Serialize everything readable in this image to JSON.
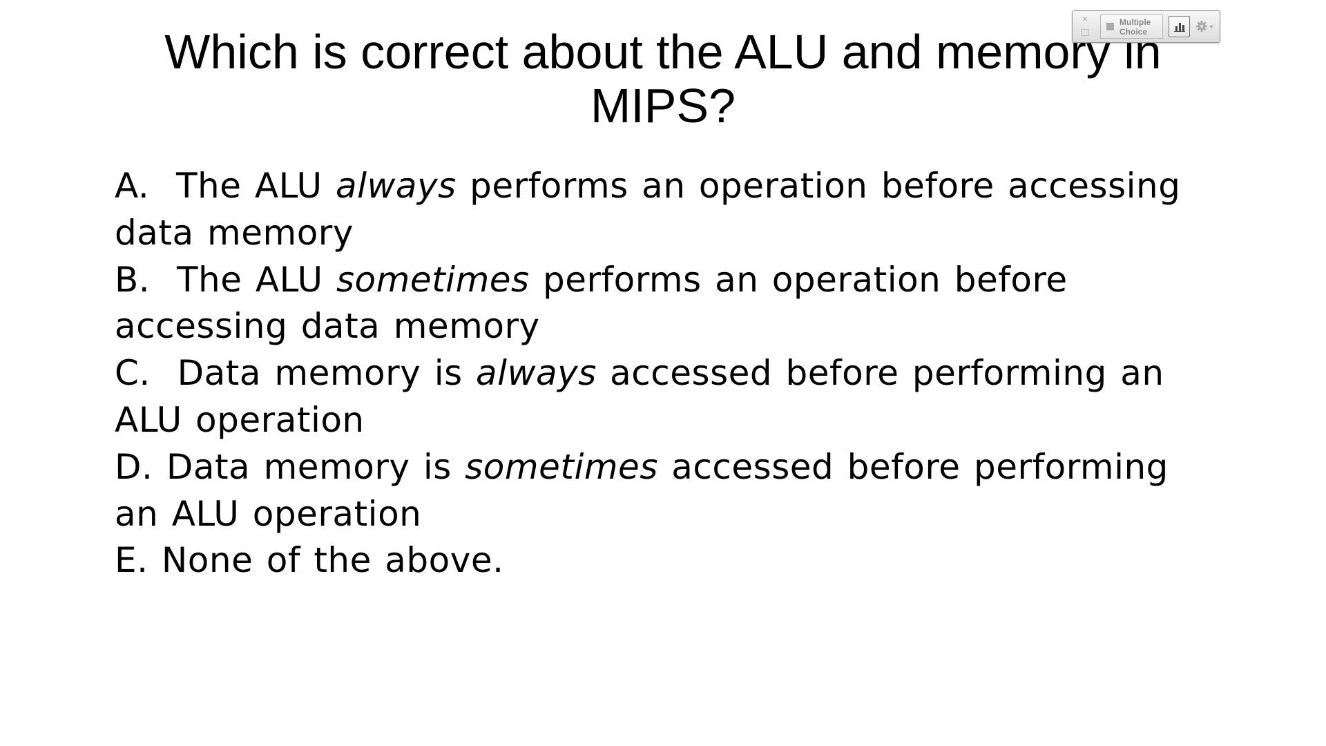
{
  "slide": {
    "title": "Which is correct about the ALU and memory in MIPS?",
    "choices": [
      {
        "letter": "A.",
        "lead": "The ALU",
        "emphasis": "always",
        "rest": "performs an operation before accessing data memory"
      },
      {
        "letter": "B.",
        "lead": "The ALU",
        "emphasis": "sometimes",
        "rest": "performs an operation before accessing data memory"
      },
      {
        "letter": "C.",
        "lead": "Data memory is",
        "emphasis": "always",
        "rest": "accessed before performing an ALU operation"
      },
      {
        "letter": "D.",
        "lead": "Data memory is",
        "emphasis": "sometimes",
        "rest": "accessed before performing an ALU operation"
      },
      {
        "letter": "E.",
        "lead": "None of the above.",
        "emphasis": "",
        "rest": ""
      }
    ]
  },
  "poll_widget": {
    "close_glyph": "×",
    "question_type_label": "Multiple Choice",
    "icons": {
      "close": "close-icon",
      "side": "window-icon",
      "type": "square-icon",
      "results": "bar-chart-icon",
      "settings": "gear-icon",
      "dropdown": "caret-down-icon"
    },
    "colors": {
      "panel": "#dcdcdc",
      "icon": "#a8a8a8",
      "chart_icon": "#444444"
    }
  }
}
